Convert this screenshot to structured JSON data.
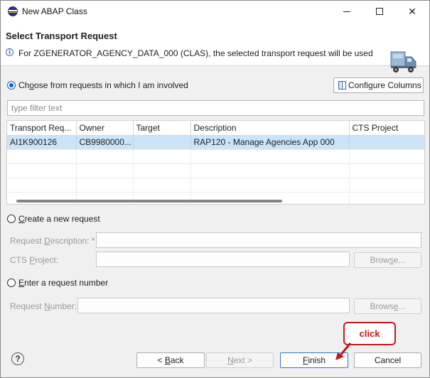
{
  "window": {
    "title": "New ABAP Class"
  },
  "header": {
    "title": "Select Transport Request",
    "message": "For ZGENERATOR_AGENCY_DATA_000 (CLAS), the selected transport request will be used"
  },
  "choose_requests": {
    "label_pre": "Ch",
    "label_mnemonic": "o",
    "label_post": "ose from requests in which I am involved",
    "selected": true
  },
  "configure_columns": {
    "label_pre": "Confi",
    "label_mnemonic": "g",
    "label_post": "ure Columns"
  },
  "filter": {
    "placeholder": "type filter text",
    "value": ""
  },
  "table": {
    "columns": [
      "Transport Req...",
      "Owner",
      "Target",
      "Description",
      "CTS Project"
    ],
    "rows": [
      {
        "transport": "AI1K900126",
        "owner": "CB9980000...",
        "target": "",
        "description": "RAP120 - Manage Agencies App 000",
        "cts_project": ""
      }
    ],
    "selected_row": 0
  },
  "create_request": {
    "label_mnemonic": "C",
    "label_post": "reate a new request",
    "selected": false,
    "description_label_pre": "Request ",
    "description_label_mnemonic": "D",
    "description_label_post": "escription: *",
    "cts_label_pre": "CTS ",
    "cts_label_mnemonic": "P",
    "cts_label_post": "roject:",
    "browse_label_pre": "Brow",
    "browse_label_mnemonic": "s",
    "browse_label_post": "e..."
  },
  "enter_request": {
    "label_mnemonic": "E",
    "label_post": "nter a request number",
    "selected": false,
    "number_label_pre": "Request ",
    "number_label_mnemonic": "N",
    "number_label_post": "umber:",
    "browse_label_pre": "Brows",
    "browse_label_mnemonic": "e",
    "browse_label_post": "..."
  },
  "footer": {
    "help_icon": "?",
    "back_pre": "< ",
    "back_mnemonic": "B",
    "back_post": "ack",
    "next_mnemonic": "N",
    "next_post": "ext >",
    "finish_mnemonic": "F",
    "finish_post": "inish",
    "cancel": "Cancel"
  },
  "annotation": {
    "callout": "click",
    "color": "#c8161d"
  },
  "colors": {
    "accent": "#0a64c8",
    "selection": "#cce4f7"
  }
}
